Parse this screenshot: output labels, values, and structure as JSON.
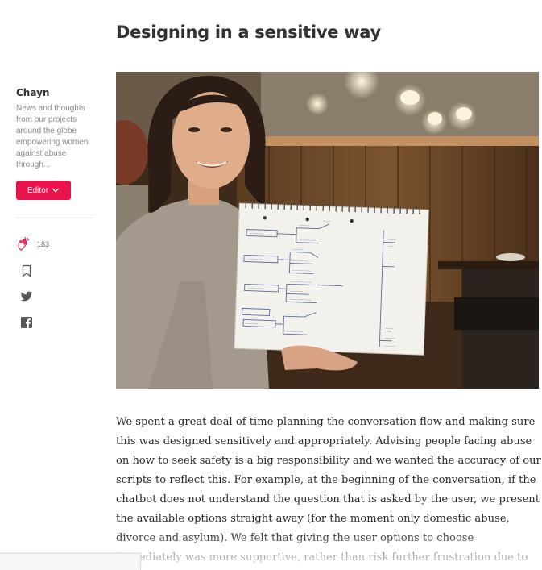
{
  "article": {
    "heading": "Designing in a sensitive way",
    "body": "We spent a great deal of time planning the conversation flow and making sure this was designed sensitively and appropriately. Advising people facing abuse on how to seek safety is a big responsibility and we wanted the accuracy of our scripts to reflect this. For example, at the beginning of the conversation, if the chatbot does not understand the question that is asked by the user, we present the available options straight away (for the moment only domestic abuse, divorce and asylum). We felt that giving the user options to choose immediately was more supportive, rather than risk further frustration due to"
  },
  "sidebar": {
    "publication_name": "Chayn",
    "description": "News and thoughts from our projects around the globe empowering women against abuse through...",
    "editor_label": "Editor",
    "clap_count": "183"
  },
  "colors": {
    "accent": "#e8134b",
    "clap_icon": "#e8134b",
    "icon_gray": "#555555"
  },
  "icons": {
    "clap": "clap-icon",
    "bookmark": "bookmark-icon",
    "twitter": "twitter-icon",
    "facebook": "facebook-icon",
    "chevron": "chevron-down-icon"
  }
}
